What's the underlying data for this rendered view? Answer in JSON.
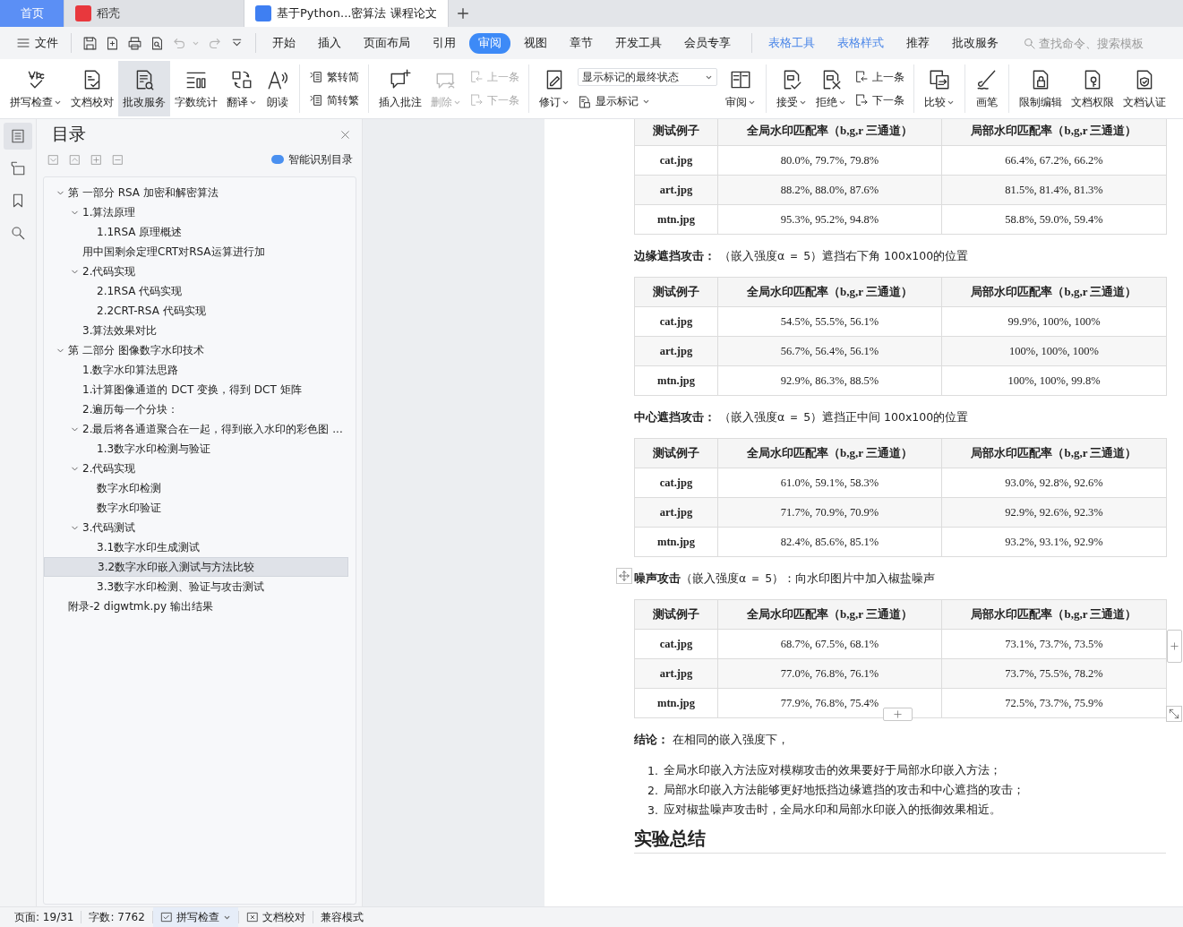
{
  "tabs": [
    {
      "label": "首页",
      "kind": "home",
      "selected": false
    },
    {
      "label": "稻壳",
      "kind": "docer",
      "selected": false
    },
    {
      "label": "基于Python...密算法 课程论文",
      "kind": "document",
      "selected": true
    }
  ],
  "menu": {
    "file_label": "文件",
    "quick_access": [
      {
        "disabled": false,
        "dropdown": false
      },
      {
        "disabled": false,
        "dropdown": false
      },
      {
        "disabled": false,
        "dropdown": false
      },
      {
        "disabled": false,
        "dropdown": false
      },
      {
        "disabled": true,
        "dropdown": true
      },
      {
        "disabled": true,
        "dropdown": false
      },
      {
        "disabled": false,
        "dropdown": false
      }
    ],
    "ribbon_tabs": [
      {
        "label": "开始",
        "kind": "main",
        "selected": false
      },
      {
        "label": "插入",
        "kind": "main",
        "selected": false
      },
      {
        "label": "页面布局",
        "kind": "main",
        "selected": false
      },
      {
        "label": "引用",
        "kind": "main",
        "selected": false
      },
      {
        "label": "审阅",
        "kind": "main",
        "selected": true
      },
      {
        "label": "视图",
        "kind": "main",
        "selected": false
      },
      {
        "label": "章节",
        "kind": "main",
        "selected": false
      },
      {
        "label": "开发工具",
        "kind": "main",
        "selected": false
      },
      {
        "label": "会员专享",
        "kind": "main",
        "selected": false
      },
      {
        "label": "表格工具",
        "kind": "context",
        "selected": false
      },
      {
        "label": "表格样式",
        "kind": "context",
        "selected": false
      },
      {
        "label": "推荐",
        "kind": "main",
        "selected": false
      },
      {
        "label": "批改服务",
        "kind": "main",
        "selected": false
      }
    ],
    "search": {
      "placeholder": "查找命令、搜索模板"
    }
  },
  "ribbon": [
    {
      "kind": "large",
      "label": "拼写检查",
      "dropdown": true,
      "disabled": false,
      "selected": false
    },
    {
      "kind": "large",
      "label": "文档校对",
      "dropdown": false,
      "disabled": false,
      "selected": false
    },
    {
      "kind": "large",
      "label": "批改服务",
      "dropdown": false,
      "disabled": false,
      "selected": true
    },
    {
      "kind": "large",
      "label": "字数统计",
      "dropdown": false,
      "disabled": false,
      "selected": false
    },
    {
      "kind": "large",
      "label": "翻译",
      "dropdown": true,
      "disabled": false,
      "selected": false
    },
    {
      "kind": "large",
      "label": "朗读",
      "dropdown": false,
      "disabled": false,
      "selected": false
    },
    {
      "kind": "separator"
    },
    {
      "kind": "stack",
      "items": [
        {
          "label": "繁转简",
          "dropdown": false,
          "disabled": false
        },
        {
          "label": "简转繁",
          "dropdown": false,
          "disabled": false
        }
      ]
    },
    {
      "kind": "separator"
    },
    {
      "kind": "large",
      "label": "插入批注",
      "dropdown": false,
      "disabled": false,
      "selected": false
    },
    {
      "kind": "large",
      "label": "删除",
      "dropdown": true,
      "disabled": true,
      "selected": false
    },
    {
      "kind": "stack",
      "items": [
        {
          "label": "上一条",
          "dropdown": false,
          "disabled": true
        },
        {
          "label": "下一条",
          "dropdown": false,
          "disabled": true
        }
      ]
    },
    {
      "kind": "separator"
    },
    {
      "kind": "large",
      "label": "修订",
      "dropdown": true,
      "disabled": false,
      "selected": false
    },
    {
      "kind": "markup",
      "value": "显示标记的最终状态",
      "items": [
        {
          "label": "显示标记",
          "dropdown": true,
          "disabled": false
        }
      ]
    },
    {
      "kind": "large",
      "label": "审阅",
      "dropdown": true,
      "disabled": false,
      "selected": false
    },
    {
      "kind": "separator"
    },
    {
      "kind": "large",
      "label": "接受",
      "dropdown": true,
      "disabled": false,
      "selected": false
    },
    {
      "kind": "large",
      "label": "拒绝",
      "dropdown": true,
      "disabled": false,
      "selected": false
    },
    {
      "kind": "stack",
      "items": [
        {
          "label": "上一条",
          "dropdown": false,
          "disabled": false
        },
        {
          "label": "下一条",
          "dropdown": false,
          "disabled": false
        }
      ]
    },
    {
      "kind": "separator"
    },
    {
      "kind": "large",
      "label": "比较",
      "dropdown": true,
      "disabled": false,
      "selected": false
    },
    {
      "kind": "separator"
    },
    {
      "kind": "large",
      "label": "画笔",
      "dropdown": false,
      "disabled": false,
      "selected": false
    },
    {
      "kind": "separator"
    },
    {
      "kind": "large",
      "label": "限制编辑",
      "dropdown": false,
      "disabled": false,
      "selected": false
    },
    {
      "kind": "large",
      "label": "文档权限",
      "dropdown": false,
      "disabled": false,
      "selected": false
    },
    {
      "kind": "large",
      "label": "文档认证",
      "dropdown": false,
      "disabled": false,
      "selected": false
    }
  ],
  "side_buttons": [
    {
      "selected": true
    },
    {
      "selected": false
    },
    {
      "selected": false
    },
    {
      "selected": false
    }
  ],
  "toc": {
    "title": "目录",
    "smart_label": "智能识别目录",
    "items": [
      {
        "text": "第 一部分 RSA 加密和解密算法",
        "expanded": true,
        "selected": false,
        "children": [
          {
            "text": "1.算法原理",
            "expanded": true,
            "selected": false,
            "children": [
              {
                "text": "1.1RSA 原理概述",
                "selected": false
              }
            ]
          },
          {
            "text": "用中国剩余定理CRT对RSA运算进行加",
            "selected": false
          },
          {
            "text": "2.代码实现",
            "expanded": true,
            "selected": false,
            "children": [
              {
                "text": "2.1RSA 代码实现",
                "selected": false
              },
              {
                "text": "2.2CRT-RSA 代码实现",
                "selected": false
              }
            ]
          },
          {
            "text": "3.算法效果对比",
            "selected": false
          }
        ]
      },
      {
        "text": "第 二部分 图像数字水印技术",
        "expanded": true,
        "selected": false,
        "children": [
          {
            "text": "1.数字水印算法思路",
            "selected": false
          },
          {
            "text": "1.计算图像通道的 DCT 变换，得到 DCT 矩阵",
            "selected": false
          },
          {
            "text": "2.遍历每一个分块：",
            "selected": false
          },
          {
            "text": "2.最后将各通道聚合在一起，得到嵌入水印的彩色图 ...",
            "expanded": true,
            "selected": false,
            "children": [
              {
                "text": "1.3数字水印检测与验证",
                "selected": false
              }
            ]
          },
          {
            "text": "2.代码实现",
            "expanded": true,
            "selected": false,
            "children": [
              {
                "text": "数字水印检测",
                "selected": false
              },
              {
                "text": "数字水印验证",
                "selected": false
              }
            ]
          },
          {
            "text": "3.代码测试",
            "expanded": true,
            "selected": false,
            "children": [
              {
                "text": "3.1数字水印生成测试",
                "selected": false
              },
              {
                "text": "3.2数字水印嵌入测试与方法比较",
                "selected": true
              },
              {
                "text": "3.3数字水印检测、验证与攻击测试",
                "selected": false
              }
            ]
          }
        ]
      },
      {
        "text": "附录-2 digwtmk.py 输出结果",
        "selected": false
      }
    ]
  },
  "document": {
    "blocks": [
      {
        "kind": "table",
        "columns": [
          "测试例子",
          "全局水印匹配率（b,g,r 三通道）",
          "局部水印匹配率（b,g,r 三通道）"
        ],
        "rows": [
          [
            "cat.jpg",
            "80.0%, 79.7%, 79.8%",
            "66.4%, 67.2%, 66.2%"
          ],
          [
            "art.jpg",
            "88.2%, 88.0%, 87.6%",
            "81.5%, 81.4%, 81.3%"
          ],
          [
            "mtn.jpg",
            "95.3%, 95.2%, 94.8%",
            "58.8%, 59.0%, 59.4%"
          ]
        ]
      },
      {
        "kind": "caption",
        "text": "**边缘遮挡攻击：** （嵌入强度α ＝ 5）遮挡右下角 100x100的位置"
      },
      {
        "kind": "table",
        "columns": [
          "测试例子",
          "全局水印匹配率（b,g,r 三通道）",
          "局部水印匹配率（b,g,r 三通道）"
        ],
        "rows": [
          [
            "cat.jpg",
            "54.5%, 55.5%, 56.1%",
            "99.9%, 100%, 100%"
          ],
          [
            "art.jpg",
            "56.7%, 56.4%, 56.1%",
            "100%, 100%, 100%"
          ],
          [
            "mtn.jpg",
            "92.9%, 86.3%, 88.5%",
            "100%, 100%, 99.8%"
          ]
        ]
      },
      {
        "kind": "caption",
        "text": "**中心遮挡攻击：** （嵌入强度α ＝ 5）遮挡正中间 100x100的位置"
      },
      {
        "kind": "table",
        "columns": [
          "测试例子",
          "全局水印匹配率（b,g,r 三通道）",
          "局部水印匹配率（b,g,r 三通道）"
        ],
        "rows": [
          [
            "cat.jpg",
            "61.0%, 59.1%, 58.3%",
            "93.0%, 92.8%, 92.6%"
          ],
          [
            "art.jpg",
            "71.7%, 70.9%, 70.9%",
            "92.9%, 92.6%, 92.3%"
          ],
          [
            "mtn.jpg",
            "82.4%, 85.6%, 85.1%",
            "93.2%, 93.1%, 92.9%"
          ]
        ]
      },
      {
        "kind": "caption",
        "text": "**噪声攻击**（嵌入强度α ＝ 5）：向水印图片中加入椒盐噪声"
      },
      {
        "kind": "table",
        "columns": [
          "测试例子",
          "全局水印匹配率（b,g,r 三通道）",
          "局部水印匹配率（b,g,r 三通道）"
        ],
        "rows": [
          [
            "cat.jpg",
            "68.7%, 67.5%, 68.1%",
            "73.1%, 73.7%, 73.5%"
          ],
          [
            "art.jpg",
            "77.0%, 76.8%, 76.1%",
            "73.7%, 75.5%, 78.2%"
          ],
          [
            "mtn.jpg",
            "77.9%, 76.8%, 75.4%",
            "72.5%, 73.7%, 75.9%"
          ]
        ]
      },
      {
        "kind": "caption",
        "text": "**结论：** 在相同的嵌入强度下，"
      },
      {
        "kind": "list",
        "items": [
          {
            "number": "1.",
            "text": "全局水印嵌入方法应对模糊攻击的效果要好于局部水印嵌入方法；"
          },
          {
            "number": "2.",
            "text": "局部水印嵌入方法能够更好地抵挡边缘遮挡的攻击和中心遮挡的攻击；"
          },
          {
            "number": "3.",
            "text": "应对椒盐噪声攻击时，全局水印和局部水印嵌入的抵御效果相近。"
          }
        ]
      },
      {
        "kind": "heading",
        "text": "实验总结"
      }
    ]
  },
  "status_bar": [
    {
      "kind": "text",
      "label": "页面: 19/31",
      "on": false
    },
    {
      "kind": "text",
      "label": "字数: 7762",
      "on": false
    },
    {
      "kind": "spell",
      "label": "拼写检查",
      "on": true
    },
    {
      "kind": "proof",
      "label": "文档校对",
      "on": false
    },
    {
      "kind": "text",
      "label": "兼容模式",
      "on": false
    }
  ]
}
